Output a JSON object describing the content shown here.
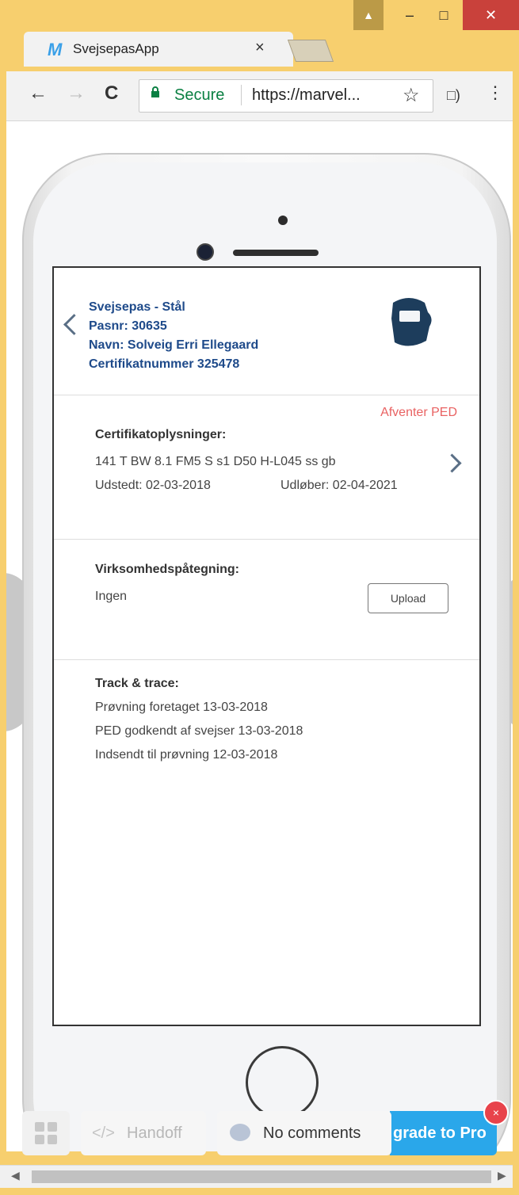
{
  "browser": {
    "tab_title": "SvejsepasApp",
    "tab_icon": "M",
    "tab_close": "×",
    "window_min": "–",
    "window_max": "□",
    "window_close": "✕",
    "secure_label": "Secure",
    "url": "https://marvel...",
    "star": "☆",
    "menu": "⋮",
    "back": "←",
    "forward": "→",
    "reload": "C"
  },
  "app": {
    "header": {
      "line1": "Svejsepas - Stål",
      "line2": "Pasnr: 30635",
      "line3": "Navn: Solveig Erri Ellegaard",
      "line4": "Certifikatnummer 325478"
    },
    "certificate": {
      "status": "Afventer PED",
      "title": "Certifikatoplysninger:",
      "code": "141 T BW 8.1 FM5 S s1 D50 H-L045 ss gb",
      "issued": "Udstedt: 02-03-2018",
      "expires": "Udløber: 02-04-2021"
    },
    "company": {
      "title": "Virksomhedspåtegning:",
      "value": "Ingen",
      "upload_label": "Upload"
    },
    "track": {
      "title": "Track & trace:",
      "items": [
        "Prøvning foretaget 13-03-2018",
        "PED godkendt af svejser 13-03-2018",
        "Indsendt til prøvning 12-03-2018"
      ]
    }
  },
  "toolbar": {
    "handoff_icon": "</>",
    "handoff_label": "Handoff",
    "comments_label": "No comments",
    "upgrade_label": "grade to Pro",
    "close": "×"
  },
  "colors": {
    "window_frame": "#f7cf6e",
    "accent_blue": "#1e4a8a",
    "status_red": "#e96262",
    "upgrade_blue": "#2aa7ea"
  }
}
